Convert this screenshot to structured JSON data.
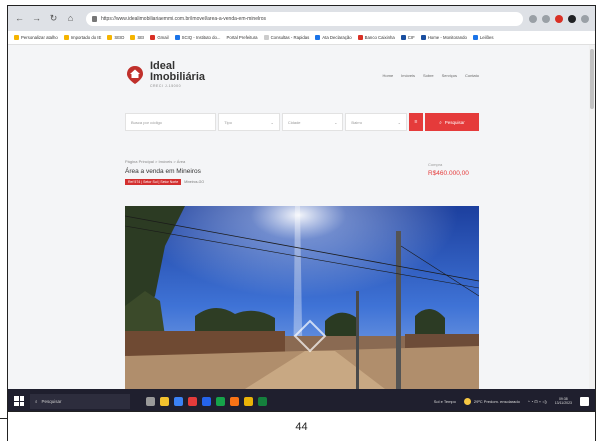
{
  "browser": {
    "url": "https://www.idealimobiliariaemmi.com.br/imovel/area-a-venda-em-minelros"
  },
  "bookmarks": [
    {
      "label": "Personalizar atalho"
    },
    {
      "label": "Importado do IE"
    },
    {
      "label": "SEID"
    },
    {
      "label": "SEI"
    },
    {
      "label": "Gmail"
    },
    {
      "label": "SCIQ - Instituto do..."
    },
    {
      "label": "Portal Prefeitura"
    },
    {
      "label": "Consultas - Rapidas"
    },
    {
      "label": "Ata Declaração"
    },
    {
      "label": "Banco Caixinha"
    },
    {
      "label": "CIF"
    },
    {
      "label": "Home - Monitorando"
    },
    {
      "label": "Leilões"
    }
  ],
  "site": {
    "logo_line1": "Ideal",
    "logo_line2": "Imobiliária",
    "logo_tagline": "CRECI J-15000",
    "menu": [
      "Home",
      "Imóveis",
      "Sobre",
      "Serviços",
      "Contato"
    ]
  },
  "search": {
    "field1": "Busca por código",
    "field2": "Tipo",
    "field3": "Cidade",
    "field4": "Bairro",
    "button": "Pesquisar"
  },
  "listing": {
    "breadcrumb": "Página Principal  >  Imóveis  >  Área",
    "title": "Área a venda em Mineiros",
    "badge": "Ref 574 | Setor Sul | Setor Norte",
    "badge_sub": "Mineiros-GO",
    "price_label": "Compra",
    "price": "R$460.000,00"
  },
  "taskbar": {
    "search_placeholder": "Pesquisar",
    "weather": "Sol e Tempo",
    "status_item": "29ºC Predom. ensolarado",
    "time": "09:38",
    "date": "13/11/2023"
  },
  "document": {
    "page_number": "44"
  },
  "colors": {
    "accent": "#e53b3b",
    "taskbar": "#1f1f2e"
  }
}
